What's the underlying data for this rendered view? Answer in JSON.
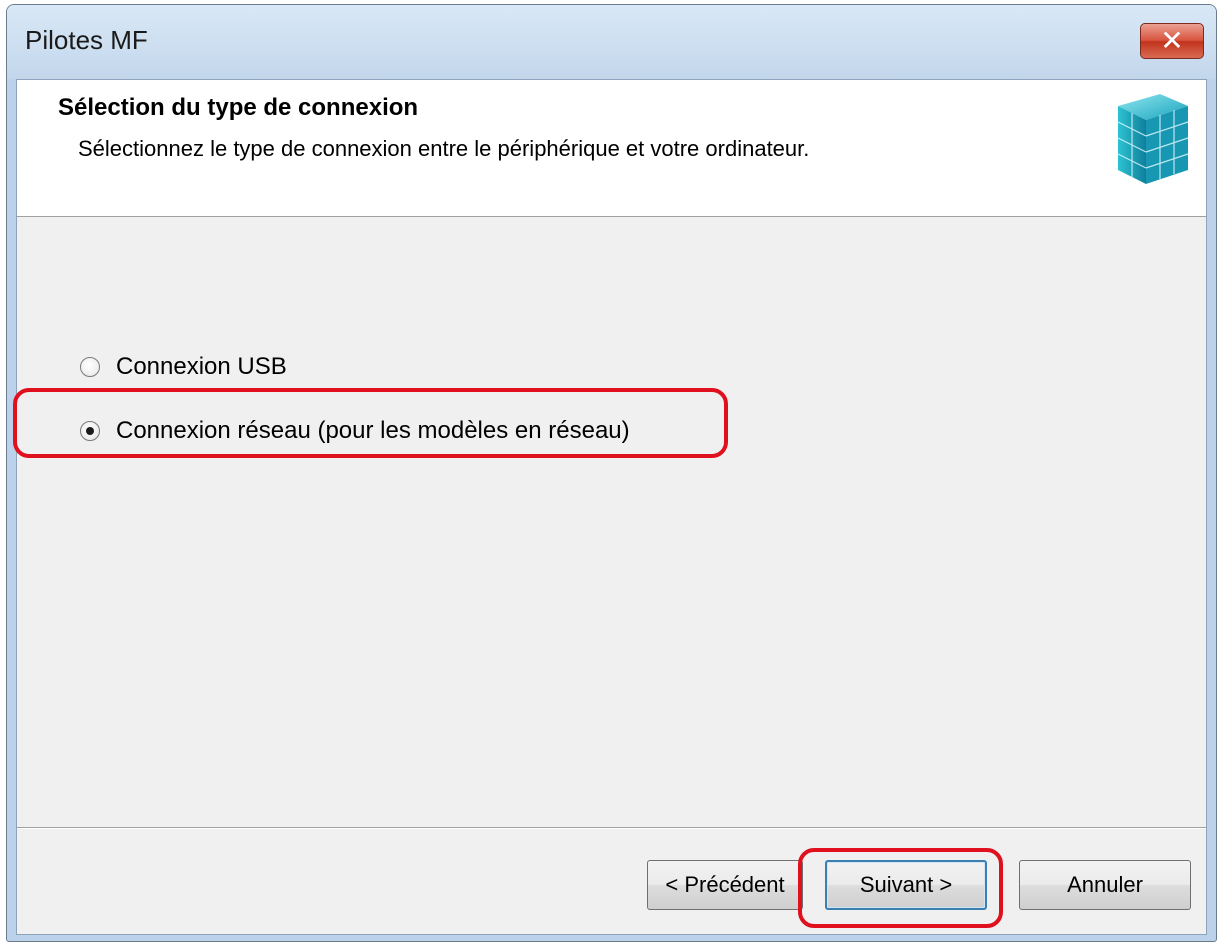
{
  "window": {
    "title": "Pilotes MF",
    "close_label": "✕"
  },
  "header": {
    "title": "Sélection du type de connexion",
    "subtitle": "Sélectionnez le type de connexion entre le périphérique et votre ordinateur.",
    "icon": "printer-cube-icon"
  },
  "options": [
    {
      "label": "Connexion USB",
      "checked": false
    },
    {
      "label": "Connexion réseau (pour les modèles en réseau)",
      "checked": true
    }
  ],
  "buttons": {
    "back": "< Précédent",
    "next": "Suivant >",
    "cancel": "Annuler"
  },
  "colors": {
    "highlight": "#e0101e",
    "logo": "#2bb8cc"
  }
}
